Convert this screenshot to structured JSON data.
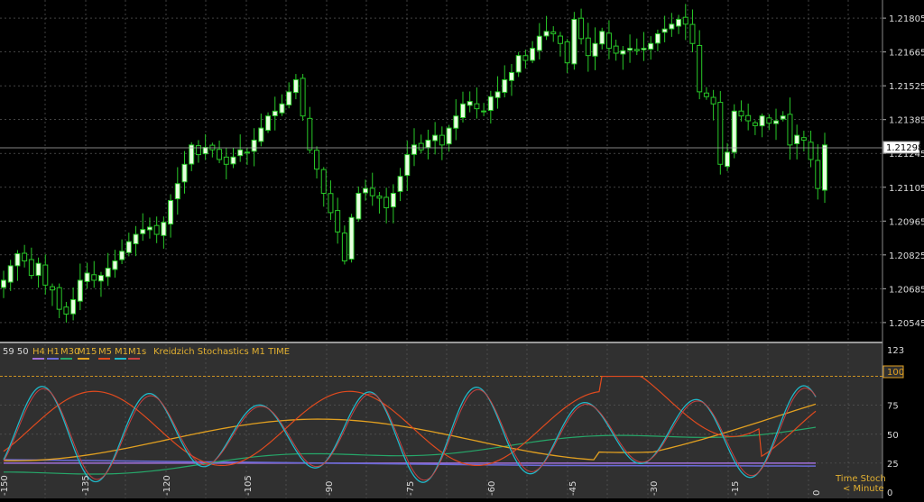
{
  "chart_data": [
    {
      "type": "candlestick",
      "title": "",
      "ylabel": "",
      "y_ticks": [
        "1.21805",
        "1.21665",
        "1.21525",
        "1.21385",
        "1.21245",
        "1.21105",
        "1.20965",
        "1.20825",
        "1.20685",
        "1.20545"
      ],
      "ylim": [
        1.2047,
        1.2188
      ],
      "grid": true,
      "current_price": "1.21298",
      "ohlc_close_path": [
        1.2072,
        1.2078,
        1.2083,
        1.208,
        1.2074,
        1.2079,
        1.207,
        1.2068,
        1.206,
        1.2058,
        1.2064,
        1.2072,
        1.2075,
        1.2072,
        1.2074,
        1.2077,
        1.208,
        1.2084,
        1.2088,
        1.2091,
        1.2093,
        1.2094,
        1.2091,
        1.2096,
        1.2105,
        1.2112,
        1.212,
        1.2128,
        1.2124,
        1.2127,
        1.2126,
        1.2122,
        1.212,
        1.2123,
        1.2126,
        1.2125,
        1.213,
        1.2135,
        1.214,
        1.2142,
        1.2145,
        1.215,
        1.2155,
        1.214,
        1.2126,
        1.2118,
        1.2108,
        1.21,
        1.2092,
        1.208,
        1.2098,
        1.2108,
        1.211,
        1.2107,
        1.2106,
        1.2102,
        1.2108,
        1.2115,
        1.2124,
        1.2128,
        1.2126,
        1.213,
        1.2132,
        1.2128,
        1.2135,
        1.214,
        1.2145,
        1.2146,
        1.2143,
        1.2142,
        1.2148,
        1.215,
        1.2155,
        1.2158,
        1.2165,
        1.2163,
        1.2168,
        1.2173,
        1.2175,
        1.2174,
        1.217,
        1.2162,
        1.218,
        1.2172,
        1.2165,
        1.217,
        1.2175,
        1.2168,
        1.2166,
        1.2167,
        1.2168,
        1.2167,
        1.2168,
        1.217,
        1.2174,
        1.2176,
        1.2178,
        1.218,
        1.2178,
        1.217,
        1.215,
        1.2148,
        1.2145,
        1.212,
        1.2125,
        1.2142,
        1.214,
        1.2138,
        1.2136,
        1.214,
        1.2137,
        1.2138,
        1.214,
        1.2128,
        1.2132,
        1.213,
        1.2122,
        1.211,
        1.2128
      ]
    },
    {
      "type": "line",
      "title": "Kreidzich Stochastics  M1 TIME",
      "header_value": "59 50",
      "legend_position": "top-left",
      "series": [
        {
          "name": "H4",
          "color": "#a070d8"
        },
        {
          "name": "H1",
          "color": "#6a6ad8"
        },
        {
          "name": "M30",
          "color": "#26a86a"
        },
        {
          "name": "M15",
          "color": "#e2a020"
        },
        {
          "name": "M5",
          "color": "#e04a1e"
        },
        {
          "name": "M1",
          "color": "#20b8c8"
        },
        {
          "name": "M1s",
          "color": "#c84040"
        }
      ],
      "y_ticks": [
        "123",
        "100",
        "75",
        "50",
        "25",
        "0"
      ],
      "ylim": [
        0,
        123
      ],
      "level_line": "100",
      "x_ticks": [
        "-150",
        "-135",
        "-120",
        "-105",
        "-90",
        "-75",
        "-60",
        "-45",
        "-30",
        "-15",
        "0"
      ],
      "xlim": [
        -150,
        0
      ],
      "bottom_right_label_1": "Time Stoch",
      "bottom_right_label_2": "< Minute",
      "background": "#303030",
      "grid": true
    }
  ]
}
